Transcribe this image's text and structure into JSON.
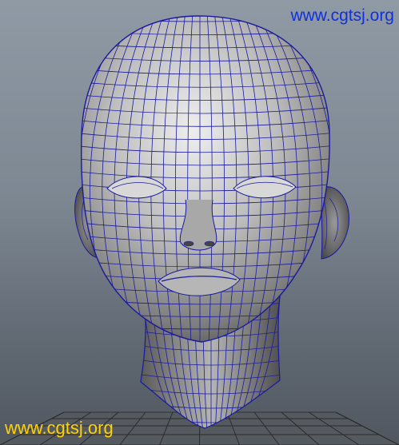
{
  "watermark_top": "www.cgtsj.org",
  "watermark_bottom": "www.cgtsj.org",
  "colors": {
    "wireframe": "#1a1a9e",
    "watermark_top": "#1030e0",
    "watermark_bottom": "#ffd200"
  },
  "icons": {
    "model": "head-wireframe-mesh",
    "floor": "perspective-ground-grid"
  }
}
